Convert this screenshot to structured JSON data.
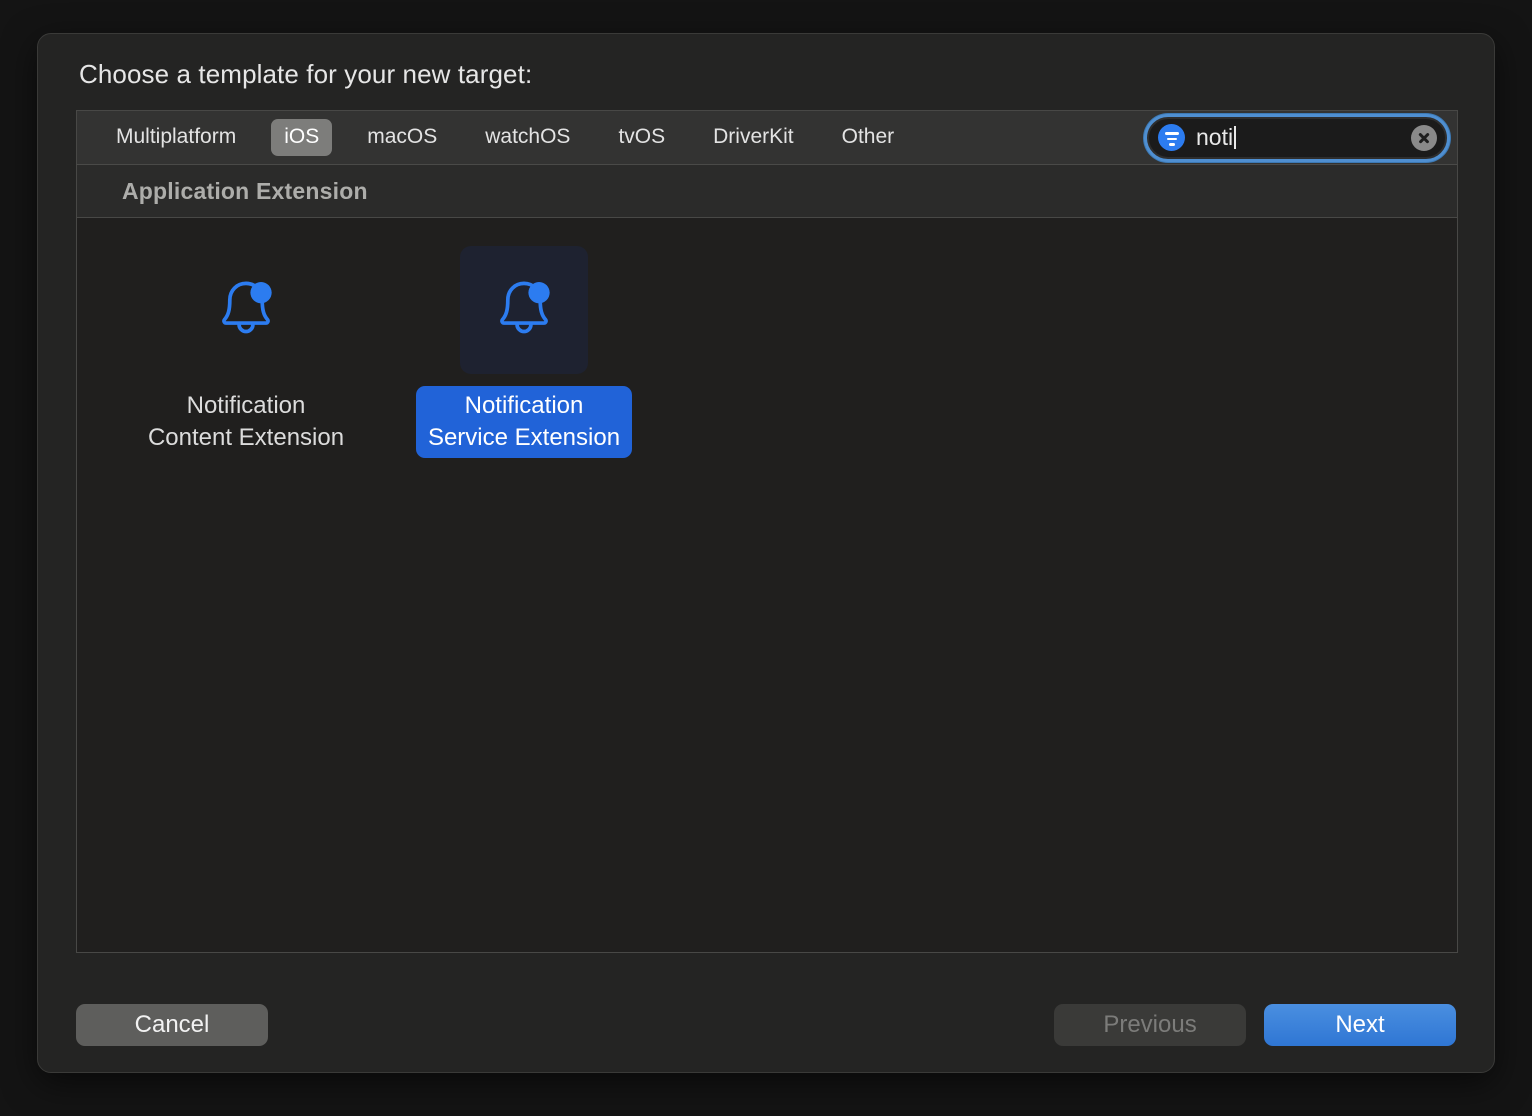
{
  "dialog": {
    "title": "Choose a template for your new target:"
  },
  "tabs": [
    {
      "label": "Multiplatform",
      "selected": false
    },
    {
      "label": "iOS",
      "selected": true
    },
    {
      "label": "macOS",
      "selected": false
    },
    {
      "label": "watchOS",
      "selected": false
    },
    {
      "label": "tvOS",
      "selected": false
    },
    {
      "label": "DriverKit",
      "selected": false
    },
    {
      "label": "Other",
      "selected": false
    }
  ],
  "search": {
    "value": "noti",
    "placeholder": "Filter",
    "badge_icon": "filter-icon",
    "clear_icon": "clear-circle-icon",
    "focused": true,
    "focus_ring_color": "#4f8fd1",
    "badge_color": "#2c7cf0"
  },
  "section": {
    "header": "Application Extension"
  },
  "templates": [
    {
      "label": "Notification\nContent Extension",
      "icon": "bell-badge-icon",
      "selected": false
    },
    {
      "label": "Notification\nService Extension",
      "icon": "bell-badge-icon",
      "selected": true
    }
  ],
  "footer": {
    "cancel": "Cancel",
    "previous": "Previous",
    "next": "Next",
    "previous_enabled": false,
    "next_accent_color": "#2f76d4"
  }
}
